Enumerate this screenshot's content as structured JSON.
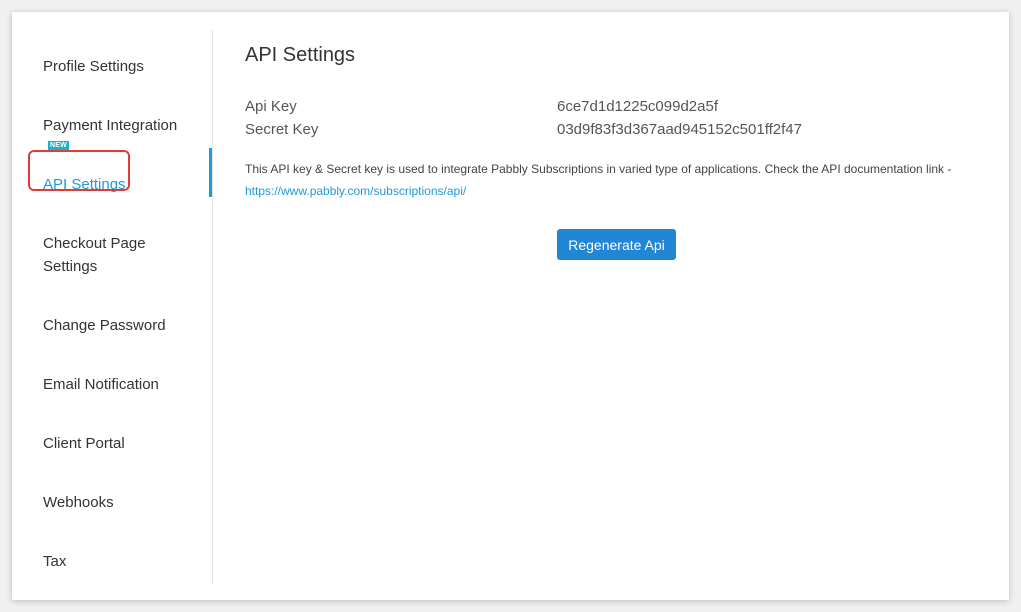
{
  "sidebar": {
    "items": [
      {
        "label": "Profile Settings"
      },
      {
        "label": "Payment Integration",
        "badge": "NEW"
      },
      {
        "label": "API Settings"
      },
      {
        "label": "Checkout Page Settings"
      },
      {
        "label": "Change Password"
      },
      {
        "label": "Email Notification"
      },
      {
        "label": "Client Portal"
      },
      {
        "label": "Webhooks"
      },
      {
        "label": "Tax"
      }
    ],
    "active": "API Settings"
  },
  "main": {
    "title": "API Settings",
    "api_key_label": "Api Key",
    "api_key_value": "6ce7d1d1225c099d2a5f",
    "secret_key_label": "Secret Key",
    "secret_key_value": "03d9f83f3d367aad945152c501ff2f47",
    "info_text": "This API key & Secret key is used to integrate Pabbly Subscriptions in varied type of applications. Check the API documentation link -",
    "doc_link": "https://www.pabbly.com/subscriptions/api/",
    "regenerate_label": "Regenerate Api"
  },
  "colors": {
    "accent": "#1f9bd6",
    "button": "#2186d4",
    "highlight": "#e53935",
    "badge": "#19b3c8"
  }
}
